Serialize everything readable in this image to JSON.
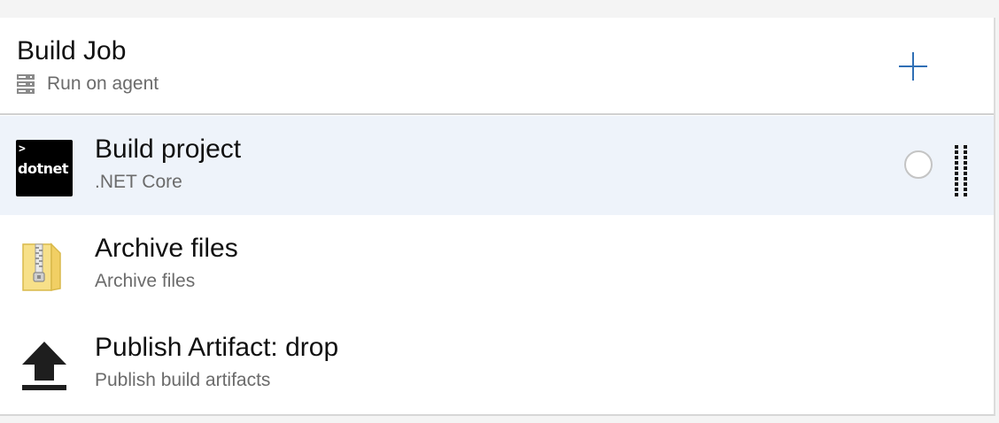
{
  "job": {
    "title": "Build Job",
    "subtitle": "Run on agent",
    "icon": "server-icon",
    "add_icon": "plus-icon"
  },
  "tasks": [
    {
      "title": "Build project",
      "subtitle": ".NET Core",
      "icon": "dotnet-icon",
      "icon_text": "dotnet",
      "icon_prompt": ">",
      "selected": true
    },
    {
      "title": "Archive files",
      "subtitle": "Archive files",
      "icon": "archive-zip-icon",
      "selected": false
    },
    {
      "title": "Publish Artifact: drop",
      "subtitle": "Publish build artifacts",
      "icon": "upload-arrow-icon",
      "selected": false
    }
  ],
  "colors": {
    "selected_row": "#eef3fa",
    "accent": "#2f6fb5",
    "secondary_text": "#6b6b6b"
  }
}
